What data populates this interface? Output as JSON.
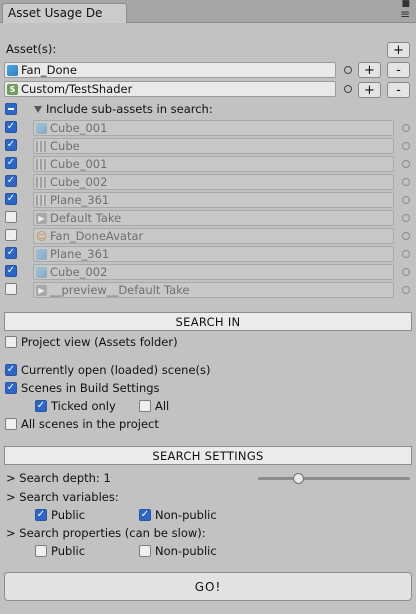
{
  "window": {
    "tab_title": "Asset Usage De",
    "icons": [
      "menu-icon",
      "maximize-icon",
      "close-icon"
    ]
  },
  "assets": {
    "label": "Asset(s):",
    "items": [
      {
        "name": "Fan_Done",
        "icon": "mesh-icon"
      },
      {
        "name": "Custom/TestShader",
        "icon": "shader-icon"
      }
    ],
    "add": "+",
    "remove": "-"
  },
  "subassets": {
    "label": "Include sub-assets in search:",
    "items": [
      {
        "name": "Cube_001",
        "checked": true,
        "icon": "mesh-icon"
      },
      {
        "name": "Cube",
        "checked": true,
        "icon": "grid-icon"
      },
      {
        "name": "Cube_001",
        "checked": true,
        "icon": "grid-icon"
      },
      {
        "name": "Cube_002",
        "checked": true,
        "icon": "grid-icon"
      },
      {
        "name": "Plane_361",
        "checked": true,
        "icon": "grid-icon"
      },
      {
        "name": "Default Take",
        "checked": false,
        "icon": "animation-icon"
      },
      {
        "name": "Fan_DoneAvatar",
        "checked": false,
        "icon": "avatar-icon"
      },
      {
        "name": "Plane_361",
        "checked": true,
        "icon": "mesh-icon"
      },
      {
        "name": "Cube_002",
        "checked": true,
        "icon": "mesh-icon"
      },
      {
        "name": "__preview__Default Take",
        "checked": false,
        "icon": "animation-icon"
      }
    ]
  },
  "search_in": {
    "header": "SEARCH IN",
    "project_view": "Project view (Assets folder)",
    "open_scenes": "Currently open (loaded) scene(s)",
    "build_scenes": "Scenes in Build Settings",
    "ticked_only": "Ticked only",
    "all": "All",
    "all_scenes": "All scenes in the project"
  },
  "search_settings": {
    "header": "SEARCH SETTINGS",
    "depth_label": "> Search depth: 1",
    "depth_value": 1,
    "depth_fraction": 0.26,
    "variables_label": "> Search variables:",
    "properties_label": "> Search properties (can be slow):",
    "public": "Public",
    "non_public": "Non-public"
  },
  "go": "GO!"
}
